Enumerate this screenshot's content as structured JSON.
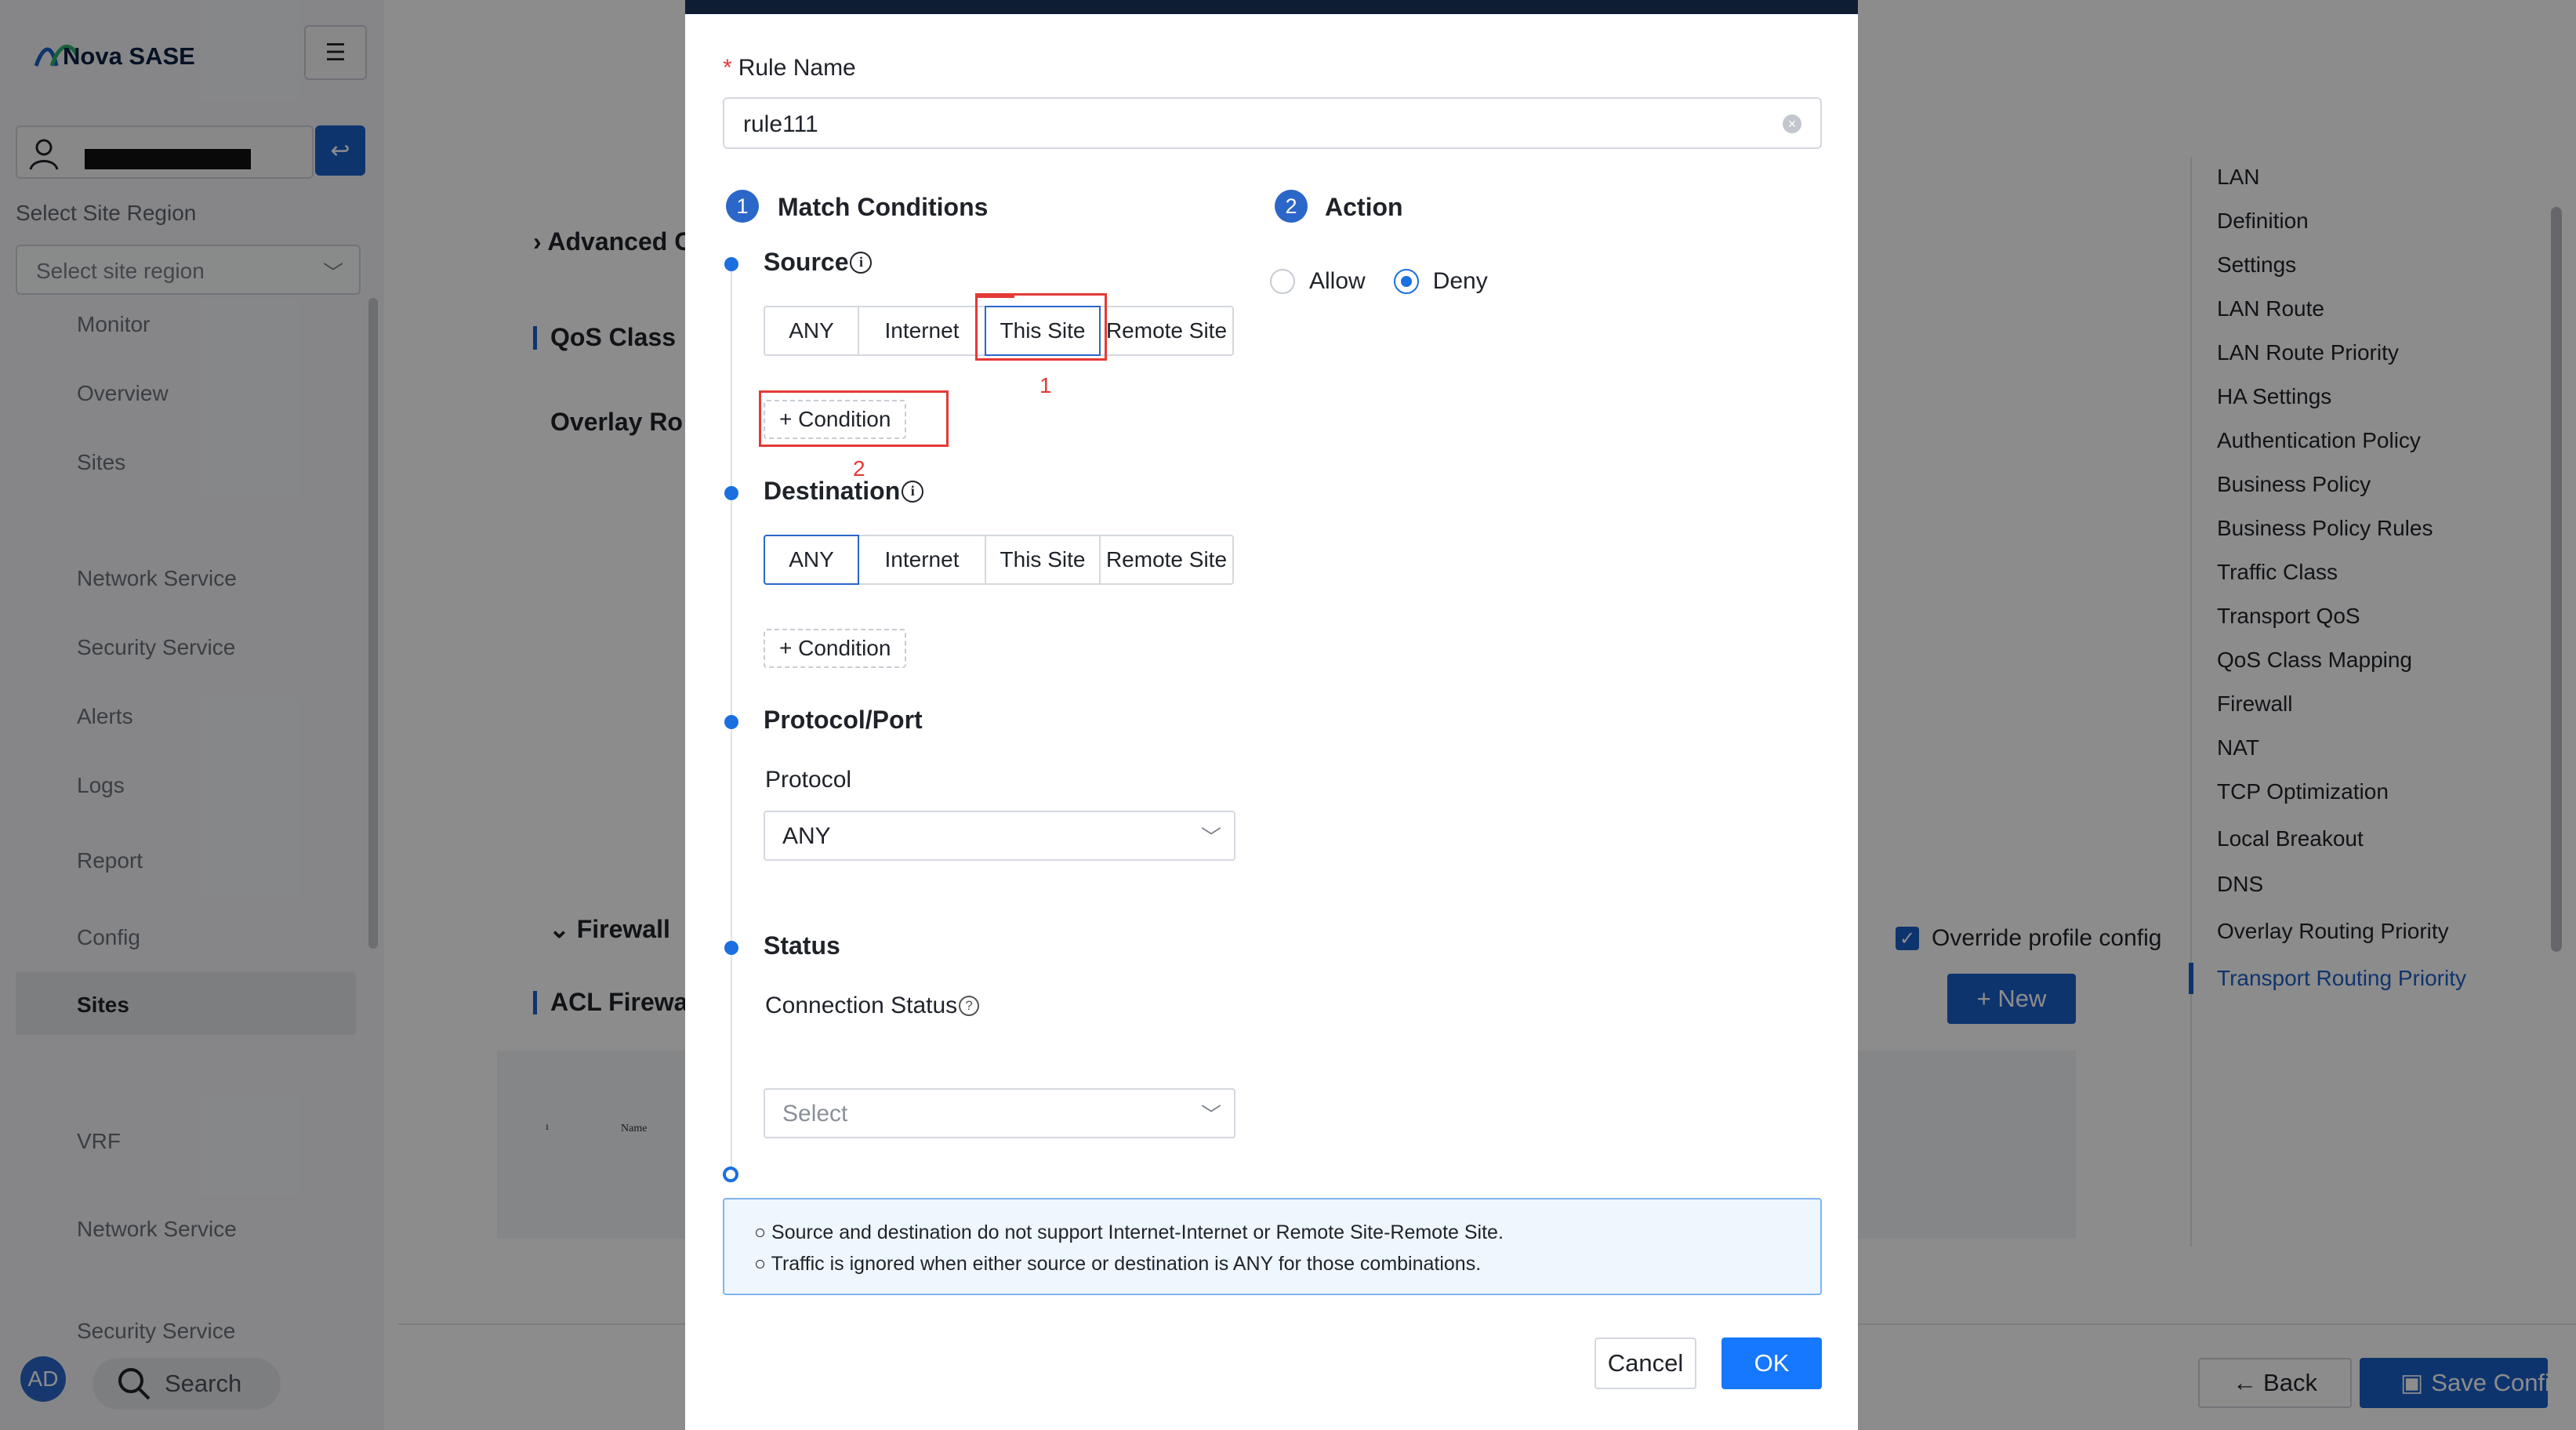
{
  "app": {
    "brand": "Nova SASE",
    "menu_icon": "hamburger-icon",
    "site_region_label": "Select Site Region",
    "site_region_placeholder": "Select site region",
    "nav": [
      "Monitor",
      "Overview",
      "Sites",
      "Network Service",
      "Security Service",
      "Alerts",
      "Logs",
      "Report",
      "Config",
      "Sites",
      "VRF",
      "Network Service",
      "Security Service"
    ],
    "active_nav": "Sites",
    "avatar": "AD",
    "search_label": "Search"
  },
  "page": {
    "sections": [
      "Advanced C",
      "QoS Class",
      "Overlay Ro",
      "Firewall",
      "ACL Firewa"
    ],
    "table_col": "Name",
    "override_label": "Override profile config",
    "new_button": "+ New",
    "back_button": "Back",
    "save_button": "Save Confi"
  },
  "anchor_nav": {
    "items": [
      "LAN",
      "Definition",
      "Settings",
      "LAN Route",
      "LAN Route Priority",
      "HA Settings",
      "Authentication Policy",
      "Business Policy",
      "Business Policy Rules",
      "Traffic Class",
      "Transport QoS",
      "QoS Class Mapping",
      "Firewall",
      "NAT",
      "TCP Optimization",
      "Local Breakout",
      "DNS",
      "Overlay Routing Priority",
      "Transport Routing Priority"
    ],
    "active": "Transport Routing Priority"
  },
  "modal": {
    "rule_name_label": "Rule Name",
    "rule_name_value": "rule111",
    "step1_num": "1",
    "step1_title": "Match Conditions",
    "step2_num": "2",
    "step2_title": "Action",
    "action_options": [
      "Allow",
      "Deny"
    ],
    "action_selected": "Deny",
    "source_title": "Source",
    "source_options": [
      "ANY",
      "Internet",
      "This Site",
      "Remote Site"
    ],
    "source_selected": "This Site",
    "destination_title": "Destination",
    "destination_options": [
      "ANY",
      "Internet",
      "This Site",
      "Remote Site"
    ],
    "destination_selected": "ANY",
    "add_condition": "+ Condition",
    "annotation_1": "1",
    "annotation_2": "2",
    "protocol_section": "Protocol/Port",
    "protocol_label": "Protocol",
    "protocol_value": "ANY",
    "status_section": "Status",
    "connection_status_label": "Connection Status",
    "connection_status_placeholder": "Select",
    "notes": [
      "○ Source and destination do not support Internet-Internet or Remote Site-Remote Site.",
      "○ Traffic is ignored when either source or destination is ANY for those combinations."
    ],
    "cancel": "Cancel",
    "ok": "OK"
  },
  "colors": {
    "primary": "#1b5fc9",
    "ok_button": "#1677ff",
    "annotation_red": "#e53935",
    "overlay": "rgba(0,0,0,0.45)"
  }
}
